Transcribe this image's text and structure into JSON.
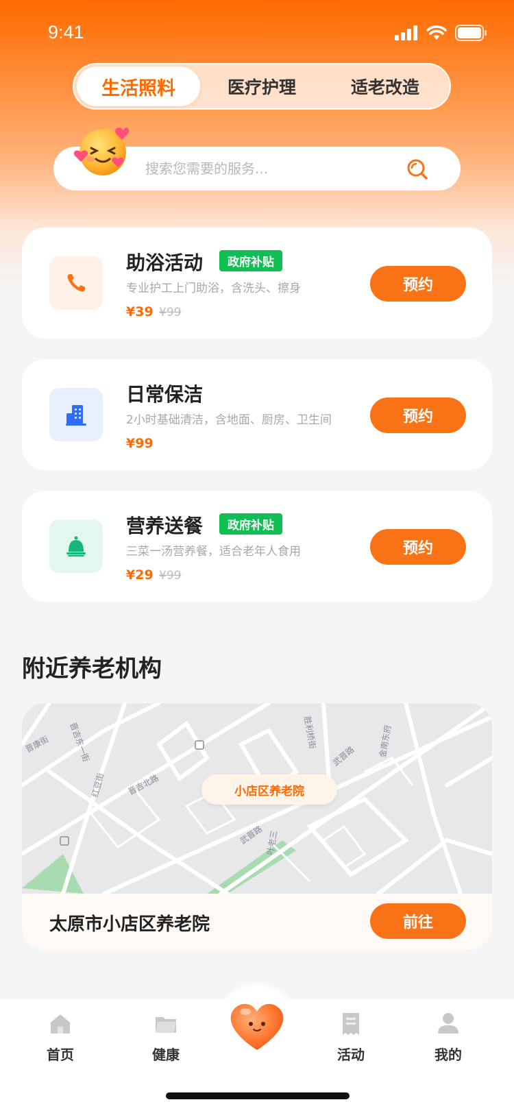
{
  "status": {
    "time": "9:41"
  },
  "tabs": [
    {
      "label": "生活照料",
      "active": true
    },
    {
      "label": "医疗护理",
      "active": false
    },
    {
      "label": "适老改造",
      "active": false
    }
  ],
  "search": {
    "placeholder": "搜索您需要的服务..."
  },
  "services": [
    {
      "title": "助浴活动",
      "tag": "政府补贴",
      "desc": "专业护工上门助浴，含洗头、擦身",
      "price": "¥39",
      "original_price": "¥99",
      "button": "预约",
      "icon": "phone-icon",
      "icon_color": "#f97316",
      "icon_bg": "#fff1e8"
    },
    {
      "title": "日常保洁",
      "tag": "",
      "desc": "2小时基础清洁，含地面、厨房、卫生间",
      "price": "¥99",
      "original_price": "",
      "button": "预约",
      "icon": "building-icon",
      "icon_color": "#2f6df6",
      "icon_bg": "#e8f0fe"
    },
    {
      "title": "营养送餐",
      "tag": "政府补贴",
      "desc": "三菜一汤营养餐，适合老年人食用",
      "price": "¥29",
      "original_price": "¥99",
      "button": "预约",
      "icon": "bell-icon",
      "icon_color": "#15b67a",
      "icon_bg": "#e3f7ef"
    }
  ],
  "nearby": {
    "title": "附近养老机构",
    "map_pin": "小店区养老院",
    "map_labels": [
      "晋康街",
      "晋吉东一街",
      "胜利桥街",
      "金南东府",
      "武晋路",
      "晋吉北路",
      "红豆街",
      "武晋路",
      "叶老三"
    ],
    "institution_name": "太原市小店区养老院",
    "go_button": "前往"
  },
  "tabbar": [
    {
      "label": "首页",
      "icon": "home-icon"
    },
    {
      "label": "健康",
      "icon": "folder-icon"
    },
    {
      "label": "",
      "icon": "heart-icon"
    },
    {
      "label": "活动",
      "icon": "receipt-icon"
    },
    {
      "label": "我的",
      "icon": "user-icon"
    }
  ],
  "colors": {
    "accent": "#f97316",
    "tag_green": "#0fbf54",
    "text": "#222222"
  }
}
